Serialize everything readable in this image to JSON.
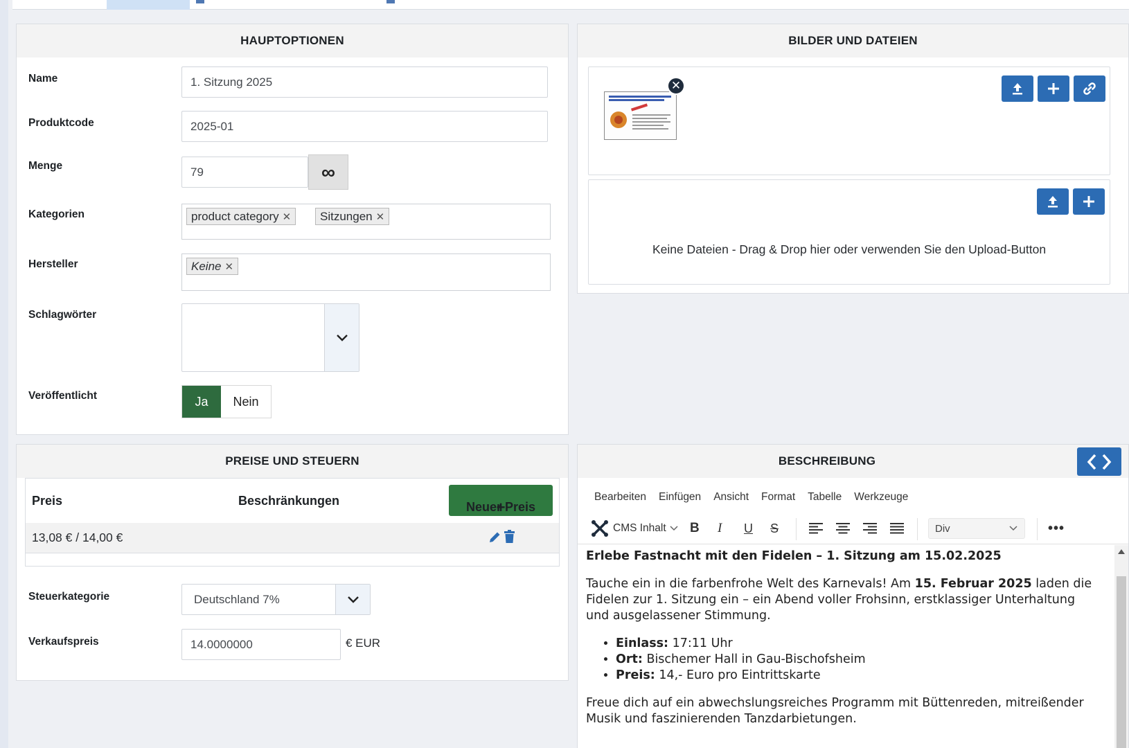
{
  "hauptoptionen": {
    "title": "HAUPTOPTIONEN",
    "name_label": "Name",
    "name_value": "1. Sitzung 2025",
    "code_label": "Produktcode",
    "code_value": "2025-01",
    "menge_label": "Menge",
    "menge_value": "79",
    "infinity_symbol": "∞",
    "kategorien_label": "Kategorien",
    "kategorien": [
      "product category",
      "Sitzungen"
    ],
    "hersteller_label": "Hersteller",
    "hersteller": [
      "Keine"
    ],
    "schlagwoerter_label": "Schlagwörter",
    "veroeffentlicht_label": "Veröffentlicht",
    "yes_label": "Ja",
    "no_label": "Nein"
  },
  "bilder": {
    "title": "BILDER UND DATEIEN",
    "no_files_text": "Keine Dateien - Drag & Drop hier oder verwenden Sie den Upload-Button"
  },
  "preise": {
    "title": "PREISE UND STEUERN",
    "col_price": "Preis",
    "col_restrictions": "Beschränkungen",
    "new_price_label": "Neuer Preis",
    "price_row": "13,08 € / 14,00 €",
    "tax_label": "Steuerkategorie",
    "tax_value": "Deutschland 7%",
    "sale_label": "Verkaufspreis",
    "sale_value": "14.0000000",
    "currency": "€ EUR"
  },
  "beschreibung": {
    "title": "BESCHREIBUNG",
    "menu": [
      "Bearbeiten",
      "Einfügen",
      "Ansicht",
      "Format",
      "Tabelle",
      "Werkzeuge"
    ],
    "cms_label": "CMS Inhalt",
    "block_format": "Div",
    "content": {
      "heading": "Erlebe Fastnacht mit den Fidelen – 1. Sitzung am 15.02.2025",
      "p1_before": "Tauche ein in die farbenfrohe Welt des Karnevals! Am ",
      "p1_bold": "15. Februar 2025",
      "p1_after": " laden die Fidelen zur 1. Sitzung ein – ein Abend voller Frohsinn, erstklassiger Unterhaltung und ausgelassener Stimmung.",
      "list": [
        {
          "label": "Einlass:",
          "text": " 17:11 Uhr"
        },
        {
          "label": "Ort:",
          "text": " Bischemer Hall in Gau-Bischofsheim"
        },
        {
          "label": "Preis:",
          "text": " 14,- Euro pro Eintrittskarte"
        }
      ],
      "p2": "Freue dich auf ein abwechslungsreiches Programm mit Büttenreden, mitreißender Musik und faszinierenden Tanzdarbietungen."
    }
  },
  "colors": {
    "primary_blue": "#2c6cb4",
    "success_green": "#2f7a40",
    "toggle_green": "#2e6b3e"
  }
}
